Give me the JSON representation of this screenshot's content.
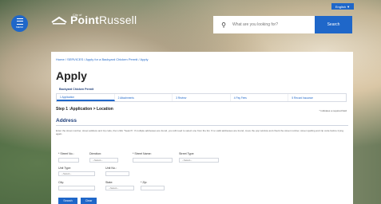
{
  "header": {
    "menu_label": "MENU",
    "city_of": "City of",
    "brand_bold": "Point",
    "brand_thin": "Russell",
    "language": "English ▼",
    "search_placeholder": "What are you looking for?",
    "search_button": "Search"
  },
  "breadcrumb": "Home / SERVICES / Apply for a Backyard Chicken Permit / Apply",
  "page_title": "Apply",
  "permit_name": "Backyard Chicken Permit",
  "steps": [
    {
      "label": "1 Application"
    },
    {
      "label": "2 Attachments"
    },
    {
      "label": "3 Review"
    },
    {
      "label": "4 Pay Fees"
    },
    {
      "label": "5 Record Issuance"
    }
  ],
  "step_heading": "Step 1 :Application > Location",
  "required_note": "* indicates a required field",
  "section_title": "Address",
  "help_text": "Enter the street number, street address and zip code, then click \"Search\". If multiple addresses are found, you will need to select one from the list. If no valid addresses are found, move the pop window and check the street number, street spelling and zip code before trying again.",
  "form": {
    "street_no_label": "* Street No.:",
    "direction_label": "Direction:",
    "direction_value": "--Select--",
    "street_name_label": "* Street Name:",
    "street_type_label": "Street Type:",
    "street_type_value": "--Select--",
    "unit_type_label": "Unit Type:",
    "unit_type_value": "--Select--",
    "unit_no_label": "Unit No.:",
    "city_label": "City:",
    "state_label": "State:",
    "state_value": "--Select--",
    "zip_label": "* Zip:"
  },
  "buttons": {
    "search": "Search",
    "clear": "Clear"
  }
}
